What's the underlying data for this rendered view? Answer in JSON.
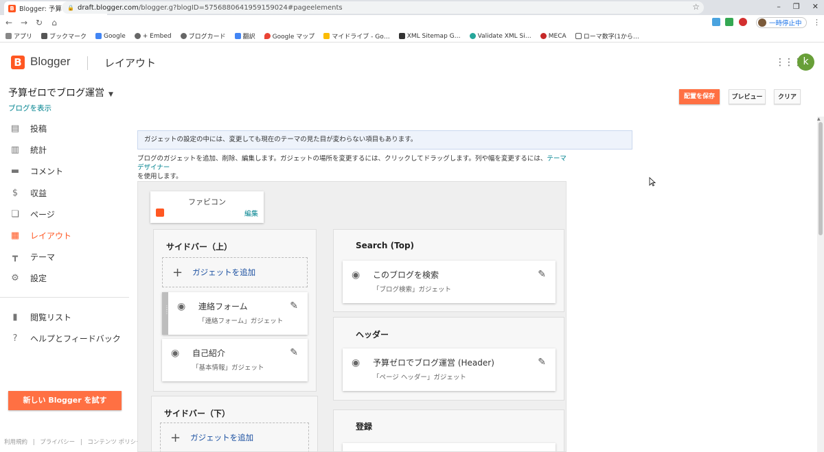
{
  "browser": {
    "tab_title": "Blogger: 予算ゼロでブログ運営",
    "url_host": "draft.blogger.com",
    "url_path": "/blogger.g?blogID=5756880641959159024#pageelements",
    "pause_label": "一時停止中",
    "bookmarks": [
      "アプリ",
      "ブックマーク",
      "Google",
      "+ Embed",
      "ブログカード",
      "翻訳",
      "Google マップ",
      "マイドライブ - Go…",
      "XML Sitemap G…",
      "Validate XML Si…",
      "MECA",
      "ローマ数字(1から…"
    ]
  },
  "header": {
    "brand": "Blogger",
    "page_title": "レイアウト",
    "avatar_letter": "k"
  },
  "sidebar": {
    "blog_name": "予算ゼロでブログ運営",
    "view_blog": "ブログを表示",
    "items": [
      {
        "label": "投稿",
        "icon": "posts-icon"
      },
      {
        "label": "統計",
        "icon": "stats-icon"
      },
      {
        "label": "コメント",
        "icon": "comments-icon"
      },
      {
        "label": "収益",
        "icon": "dollar-icon"
      },
      {
        "label": "ページ",
        "icon": "pages-icon"
      },
      {
        "label": "レイアウト",
        "icon": "layout-icon"
      },
      {
        "label": "テーマ",
        "icon": "paint-roller-icon"
      },
      {
        "label": "設定",
        "icon": "gear-icon"
      }
    ],
    "items2": [
      {
        "label": "閲覧リスト",
        "icon": "bookmark-icon"
      },
      {
        "label": "ヘルプとフィードバック",
        "icon": "help-icon"
      }
    ],
    "try_button": "新しい Blogger を試す",
    "footer": [
      "利用規約",
      "|",
      "プライバシー",
      "|",
      "コンテンツ ポリシー"
    ]
  },
  "actions": {
    "save": "配置を保存",
    "preview": "プレビュー",
    "clear": "クリア"
  },
  "content": {
    "info": "ガジェットの設定の中には、変更しても現在のテーマの見た目が変わらない項目もあります。",
    "desc_before": "ブログのガジェットを追加、削除、編集します。ガジェットの場所を変更するには、クリックしてドラッグします。列や幅を変更するには、",
    "desc_link": "テーマ デザイナー",
    "desc_after": "を使用します。",
    "favicon": {
      "title": "ファビコン",
      "edit": "編集"
    },
    "sections": {
      "sidebar_top": {
        "title": "サイドバー（上）",
        "add": "ガジェットを追加",
        "gadgets": [
          {
            "name": "連絡フォーム",
            "type": "「連絡フォーム」ガジェット"
          },
          {
            "name": "自己紹介",
            "type": "「基本情報」ガジェット"
          }
        ]
      },
      "sidebar_bottom": {
        "title": "サイドバー（下）",
        "add": "ガジェットを追加"
      },
      "search_top": {
        "title": "Search (Top)",
        "gadgets": [
          {
            "name": "このブログを検索",
            "type": "「ブログ検索」ガジェット"
          }
        ]
      },
      "header": {
        "title": "ヘッダー",
        "gadgets": [
          {
            "name": "予算ゼロでブログ運営 (Header)",
            "type": "「ページ ヘッダー」ガジェット"
          }
        ]
      },
      "subscribe": {
        "title": "登録"
      }
    }
  }
}
